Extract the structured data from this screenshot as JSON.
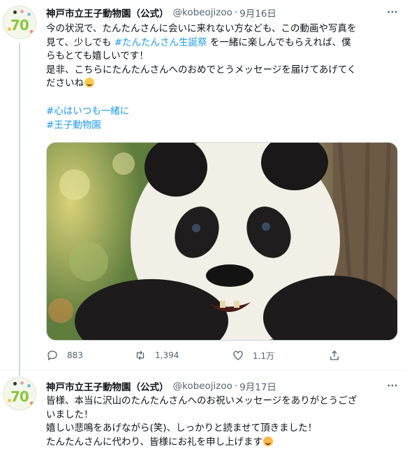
{
  "tweets": [
    {
      "author_name": "神戸市立王子動物園（公式）",
      "handle": "@kobeojizoo",
      "separator": "·",
      "date": "9月16日",
      "avatar_text": "70",
      "lines": {
        "l1": "今の状況で、たんたんさんに会いに来れない方なども、この動画や写真を",
        "l2a": "見て、少しでも ",
        "l2b": "#たんたんさん生誕祭",
        "l2c": " を一緒に楽しんでもらえれば、僕",
        "l3": "らもとても嬉しいです！",
        "l4": "是非、こちらにたんたんさんへのおめでとうメッセージを届けてあげてく",
        "l5": "ださいね"
      },
      "hashtags": [
        "#心はいつも一緒に",
        "#王子動物園"
      ],
      "photo_alt": "panda",
      "actions": {
        "reply": "883",
        "retweet": "1,394",
        "like": "1.1万"
      }
    },
    {
      "author_name": "神戸市立王子動物園（公式）",
      "handle": "@kobeojizoo",
      "separator": "·",
      "date": "9月17日",
      "avatar_text": "70",
      "lines": {
        "l1": "皆様、本当に沢山のたんたんさんへのお祝いメッセージをありがとうござ",
        "l2": "いました！",
        "l3": "嬉しい悲鳴をあげながら(笑)、しっかりと読ませて頂きました！",
        "l4": "たんたんさんに代わり、皆様にお礼を申し上げます"
      }
    }
  ],
  "icons": {
    "reply": "reply-icon",
    "retweet": "retweet-icon",
    "like": "heart-icon",
    "share": "share-icon",
    "more": "more-icon"
  },
  "colors": {
    "hashtag": "#1d9bf0",
    "secondary_text": "#536471",
    "primary_text": "#0f1419"
  }
}
